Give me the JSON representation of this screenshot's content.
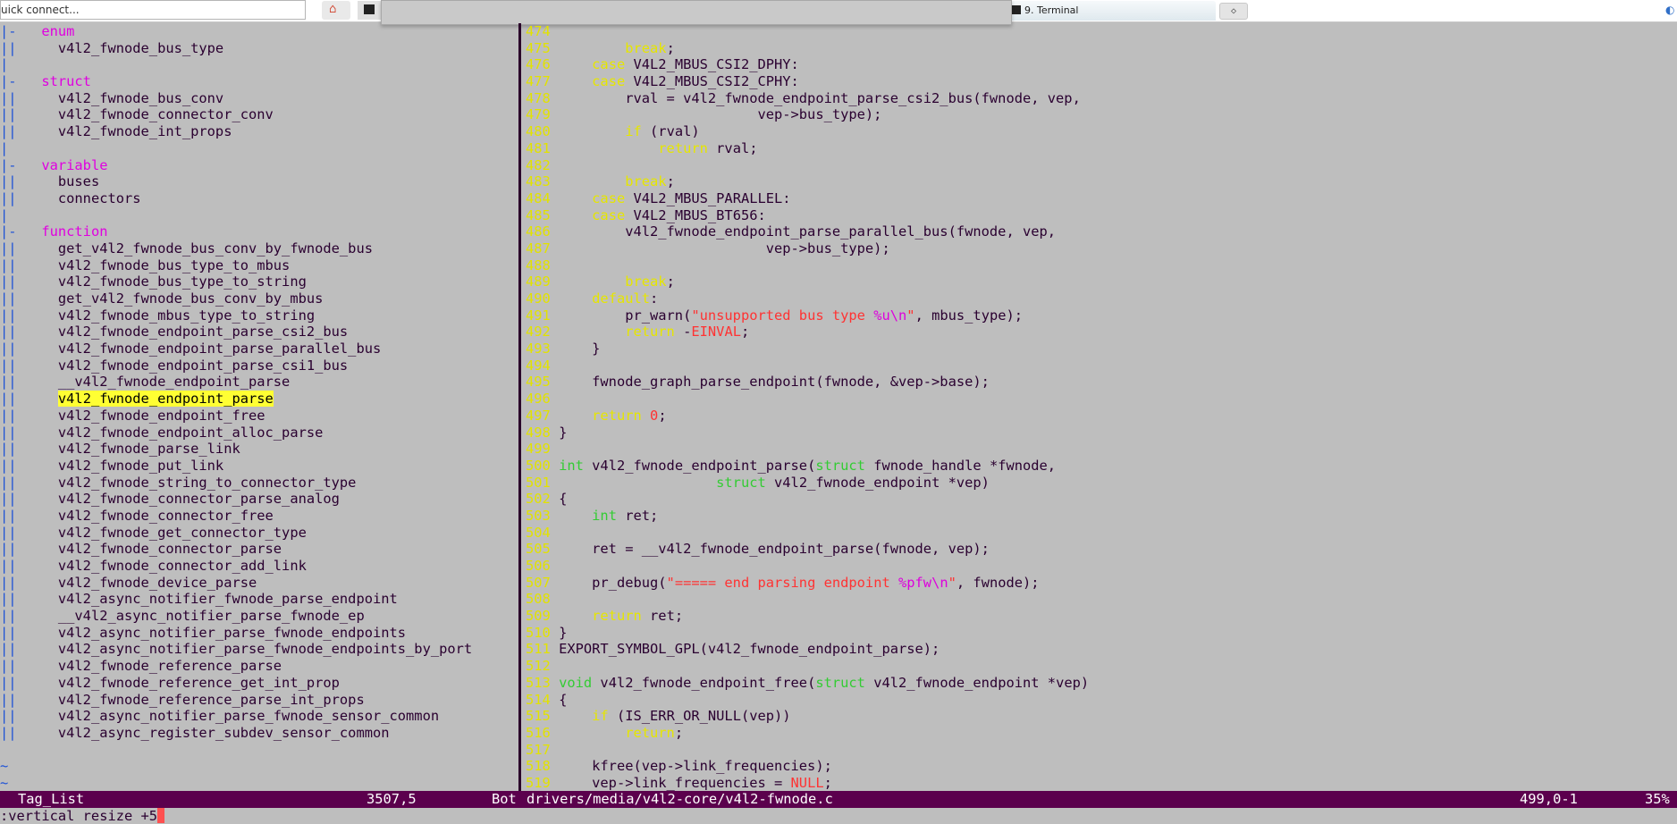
{
  "app": {
    "quick_connect_placeholder": "uick connect...",
    "terminal_tab_label": "9. Terminal",
    "home_icon": "home-icon",
    "terminal_icon": "terminal-icon"
  },
  "taglist": {
    "lines": [
      {
        "fold": "|-",
        "text": "enum",
        "kind": "header"
      },
      {
        "fold": "||",
        "text": "  v4l2_fwnode_bus_type",
        "kind": "tag"
      },
      {
        "fold": "|",
        "text": "",
        "kind": "blank"
      },
      {
        "fold": "|-",
        "text": "struct",
        "kind": "header"
      },
      {
        "fold": "||",
        "text": "  v4l2_fwnode_bus_conv",
        "kind": "tag"
      },
      {
        "fold": "||",
        "text": "  v4l2_fwnode_connector_conv",
        "kind": "tag"
      },
      {
        "fold": "||",
        "text": "  v4l2_fwnode_int_props",
        "kind": "tag"
      },
      {
        "fold": "|",
        "text": "",
        "kind": "blank"
      },
      {
        "fold": "|-",
        "text": "variable",
        "kind": "header"
      },
      {
        "fold": "||",
        "text": "  buses",
        "kind": "tag"
      },
      {
        "fold": "||",
        "text": "  connectors",
        "kind": "tag"
      },
      {
        "fold": "|",
        "text": "",
        "kind": "blank"
      },
      {
        "fold": "|-",
        "text": "function",
        "kind": "header"
      },
      {
        "fold": "||",
        "text": "  get_v4l2_fwnode_bus_conv_by_fwnode_bus",
        "kind": "tag"
      },
      {
        "fold": "||",
        "text": "  v4l2_fwnode_bus_type_to_mbus",
        "kind": "tag"
      },
      {
        "fold": "||",
        "text": "  v4l2_fwnode_bus_type_to_string",
        "kind": "tag"
      },
      {
        "fold": "||",
        "text": "  get_v4l2_fwnode_bus_conv_by_mbus",
        "kind": "tag"
      },
      {
        "fold": "||",
        "text": "  v4l2_fwnode_mbus_type_to_string",
        "kind": "tag"
      },
      {
        "fold": "||",
        "text": "  v4l2_fwnode_endpoint_parse_csi2_bus",
        "kind": "tag"
      },
      {
        "fold": "||",
        "text": "  v4l2_fwnode_endpoint_parse_parallel_bus",
        "kind": "tag"
      },
      {
        "fold": "||",
        "text": "  v4l2_fwnode_endpoint_parse_csi1_bus",
        "kind": "tag"
      },
      {
        "fold": "||",
        "text": "  __v4l2_fwnode_endpoint_parse",
        "kind": "tag"
      },
      {
        "fold": "||",
        "text": "v4l2_fwnode_endpoint_parse",
        "kind": "current"
      },
      {
        "fold": "||",
        "text": "  v4l2_fwnode_endpoint_free",
        "kind": "tag"
      },
      {
        "fold": "||",
        "text": "  v4l2_fwnode_endpoint_alloc_parse",
        "kind": "tag"
      },
      {
        "fold": "||",
        "text": "  v4l2_fwnode_parse_link",
        "kind": "tag"
      },
      {
        "fold": "||",
        "text": "  v4l2_fwnode_put_link",
        "kind": "tag"
      },
      {
        "fold": "||",
        "text": "  v4l2_fwnode_string_to_connector_type",
        "kind": "tag"
      },
      {
        "fold": "||",
        "text": "  v4l2_fwnode_connector_parse_analog",
        "kind": "tag"
      },
      {
        "fold": "||",
        "text": "  v4l2_fwnode_connector_free",
        "kind": "tag"
      },
      {
        "fold": "||",
        "text": "  v4l2_fwnode_get_connector_type",
        "kind": "tag"
      },
      {
        "fold": "||",
        "text": "  v4l2_fwnode_connector_parse",
        "kind": "tag"
      },
      {
        "fold": "||",
        "text": "  v4l2_fwnode_connector_add_link",
        "kind": "tag"
      },
      {
        "fold": "||",
        "text": "  v4l2_fwnode_device_parse",
        "kind": "tag"
      },
      {
        "fold": "||",
        "text": "  v4l2_async_notifier_fwnode_parse_endpoint",
        "kind": "tag"
      },
      {
        "fold": "||",
        "text": "  __v4l2_async_notifier_parse_fwnode_ep",
        "kind": "tag"
      },
      {
        "fold": "||",
        "text": "  v4l2_async_notifier_parse_fwnode_endpoints",
        "kind": "tag"
      },
      {
        "fold": "||",
        "text": "  v4l2_async_notifier_parse_fwnode_endpoints_by_port",
        "kind": "tag"
      },
      {
        "fold": "||",
        "text": "  v4l2_fwnode_reference_parse",
        "kind": "tag"
      },
      {
        "fold": "||",
        "text": "  v4l2_fwnode_reference_get_int_prop",
        "kind": "tag"
      },
      {
        "fold": "||",
        "text": "  v4l2_fwnode_reference_parse_int_props",
        "kind": "tag"
      },
      {
        "fold": "||",
        "text": "  v4l2_async_notifier_parse_fwnode_sensor_common",
        "kind": "tag"
      },
      {
        "fold": "||",
        "text": "  v4l2_async_register_subdev_sensor_common",
        "kind": "tag"
      },
      {
        "fold": "",
        "text": "",
        "kind": "blank"
      },
      {
        "fold": "~",
        "text": "",
        "kind": "tilde"
      },
      {
        "fold": "~",
        "text": "",
        "kind": "tilde"
      }
    ]
  },
  "editor": {
    "lines": [
      {
        "n": "474",
        "seg": []
      },
      {
        "n": "475",
        "seg": [
          [
            "        ",
            "c"
          ],
          [
            "break",
            "k"
          ],
          [
            ";",
            "c"
          ]
        ]
      },
      {
        "n": "476",
        "seg": [
          [
            "    ",
            "c"
          ],
          [
            "case",
            "k"
          ],
          [
            " V4L2_MBUS_CSI2_DPHY:",
            "c"
          ]
        ]
      },
      {
        "n": "477",
        "seg": [
          [
            "    ",
            "c"
          ],
          [
            "case",
            "k"
          ],
          [
            " V4L2_MBUS_CSI2_CPHY:",
            "c"
          ]
        ]
      },
      {
        "n": "478",
        "seg": [
          [
            "        rval = v4l2_fwnode_endpoint_parse_csi2_bus(fwnode, vep,",
            "c"
          ]
        ]
      },
      {
        "n": "479",
        "seg": [
          [
            "                        vep->bus_type);",
            "c"
          ]
        ]
      },
      {
        "n": "480",
        "seg": [
          [
            "        ",
            "c"
          ],
          [
            "if",
            "k"
          ],
          [
            " (rval)",
            "c"
          ]
        ]
      },
      {
        "n": "481",
        "seg": [
          [
            "            ",
            "c"
          ],
          [
            "return",
            "k"
          ],
          [
            " rval;",
            "c"
          ]
        ]
      },
      {
        "n": "482",
        "seg": []
      },
      {
        "n": "483",
        "seg": [
          [
            "        ",
            "c"
          ],
          [
            "break",
            "k"
          ],
          [
            ";",
            "c"
          ]
        ]
      },
      {
        "n": "484",
        "seg": [
          [
            "    ",
            "c"
          ],
          [
            "case",
            "k"
          ],
          [
            " V4L2_MBUS_PARALLEL:",
            "c"
          ]
        ]
      },
      {
        "n": "485",
        "seg": [
          [
            "    ",
            "c"
          ],
          [
            "case",
            "k"
          ],
          [
            " V4L2_MBUS_BT656:",
            "c"
          ]
        ]
      },
      {
        "n": "486",
        "seg": [
          [
            "        v4l2_fwnode_endpoint_parse_parallel_bus(fwnode, vep,",
            "c"
          ]
        ]
      },
      {
        "n": "487",
        "seg": [
          [
            "                         vep->bus_type);",
            "c"
          ]
        ]
      },
      {
        "n": "488",
        "seg": []
      },
      {
        "n": "489",
        "seg": [
          [
            "        ",
            "c"
          ],
          [
            "break",
            "k"
          ],
          [
            ";",
            "c"
          ]
        ]
      },
      {
        "n": "490",
        "seg": [
          [
            "    ",
            "c"
          ],
          [
            "default",
            "k"
          ],
          [
            ":",
            "c"
          ]
        ]
      },
      {
        "n": "491",
        "seg": [
          [
            "        pr_warn(",
            "c"
          ],
          [
            "\"unsupported bus type ",
            "s"
          ],
          [
            "%u\\n",
            "f"
          ],
          [
            "\"",
            "s"
          ],
          [
            ", mbus_type);",
            "c"
          ]
        ]
      },
      {
        "n": "492",
        "seg": [
          [
            "        ",
            "c"
          ],
          [
            "return",
            "k"
          ],
          [
            " -",
            "c"
          ],
          [
            "EINVAL",
            "s"
          ],
          [
            ";",
            "c"
          ]
        ]
      },
      {
        "n": "493",
        "seg": [
          [
            "    }",
            "c"
          ]
        ]
      },
      {
        "n": "494",
        "seg": []
      },
      {
        "n": "495",
        "seg": [
          [
            "    fwnode_graph_parse_endpoint(fwnode, &vep->base);",
            "c"
          ]
        ]
      },
      {
        "n": "496",
        "seg": []
      },
      {
        "n": "497",
        "seg": [
          [
            "    ",
            "c"
          ],
          [
            "return",
            "k"
          ],
          [
            " ",
            "c"
          ],
          [
            "0",
            "s"
          ],
          [
            ";",
            "c"
          ]
        ]
      },
      {
        "n": "498",
        "seg": [
          [
            "}",
            "c"
          ]
        ]
      },
      {
        "n": "499",
        "seg": []
      },
      {
        "n": "500",
        "seg": [
          [
            "int",
            "t"
          ],
          [
            " v4l2_fwnode_endpoint_parse(",
            "c"
          ],
          [
            "struct",
            "t"
          ],
          [
            " fwnode_handle *fwnode,",
            "c"
          ]
        ]
      },
      {
        "n": "501",
        "seg": [
          [
            "                   ",
            "c"
          ],
          [
            "struct",
            "t"
          ],
          [
            " v4l2_fwnode_endpoint *vep)",
            "c"
          ]
        ]
      },
      {
        "n": "502",
        "seg": [
          [
            "{",
            "c"
          ]
        ]
      },
      {
        "n": "503",
        "seg": [
          [
            "    ",
            "c"
          ],
          [
            "int",
            "t"
          ],
          [
            " ret;",
            "c"
          ]
        ]
      },
      {
        "n": "504",
        "seg": []
      },
      {
        "n": "505",
        "seg": [
          [
            "    ret = __v4l2_fwnode_endpoint_parse(fwnode, vep);",
            "c"
          ]
        ]
      },
      {
        "n": "506",
        "seg": []
      },
      {
        "n": "507",
        "seg": [
          [
            "    pr_debug(",
            "c"
          ],
          [
            "\"===== end parsing endpoint ",
            "s"
          ],
          [
            "%pfw\\n",
            "f"
          ],
          [
            "\"",
            "s"
          ],
          [
            ", fwnode);",
            "c"
          ]
        ]
      },
      {
        "n": "508",
        "seg": []
      },
      {
        "n": "509",
        "seg": [
          [
            "    ",
            "c"
          ],
          [
            "return",
            "k"
          ],
          [
            " ret;",
            "c"
          ]
        ]
      },
      {
        "n": "510",
        "seg": [
          [
            "}",
            "c"
          ]
        ]
      },
      {
        "n": "511",
        "seg": [
          [
            "EXPORT_SYMBOL_GPL(v4l2_fwnode_endpoint_parse);",
            "c"
          ]
        ]
      },
      {
        "n": "512",
        "seg": []
      },
      {
        "n": "513",
        "seg": [
          [
            "void",
            "t"
          ],
          [
            " v4l2_fwnode_endpoint_free(",
            "c"
          ],
          [
            "struct",
            "t"
          ],
          [
            " v4l2_fwnode_endpoint *vep)",
            "c"
          ]
        ]
      },
      {
        "n": "514",
        "seg": [
          [
            "{",
            "c"
          ]
        ]
      },
      {
        "n": "515",
        "seg": [
          [
            "    ",
            "c"
          ],
          [
            "if",
            "k"
          ],
          [
            " (IS_ERR_OR_NULL(vep))",
            "c"
          ]
        ]
      },
      {
        "n": "516",
        "seg": [
          [
            "        ",
            "c"
          ],
          [
            "return",
            "k"
          ],
          [
            ";",
            "c"
          ]
        ]
      },
      {
        "n": "517",
        "seg": []
      },
      {
        "n": "518",
        "seg": [
          [
            "    kfree(vep->link_frequencies);",
            "c"
          ]
        ]
      },
      {
        "n": "519",
        "seg": [
          [
            "    vep->link_frequencies = ",
            "c"
          ],
          [
            "NULL",
            "s"
          ],
          [
            ";",
            "c"
          ]
        ]
      }
    ]
  },
  "status": {
    "left_name": "Tag_List",
    "left_pos": "3507,5",
    "left_pct": "Bot",
    "file": "drivers/media/v4l2-core/v4l2-fwnode.c",
    "right_pos": "499,0-1",
    "right_pct": "35%"
  },
  "cmdline": ":vertical resize +5",
  "colors": {
    "background": "#bebebe",
    "statusline": "#5b004d",
    "line_number": "#e2e200",
    "keyword": "#e6e600",
    "type": "#33cc33",
    "string": "#ff3333",
    "format_spec": "#dd00dd",
    "tag_header": "#e000e0",
    "highlight": "#ffff33"
  }
}
